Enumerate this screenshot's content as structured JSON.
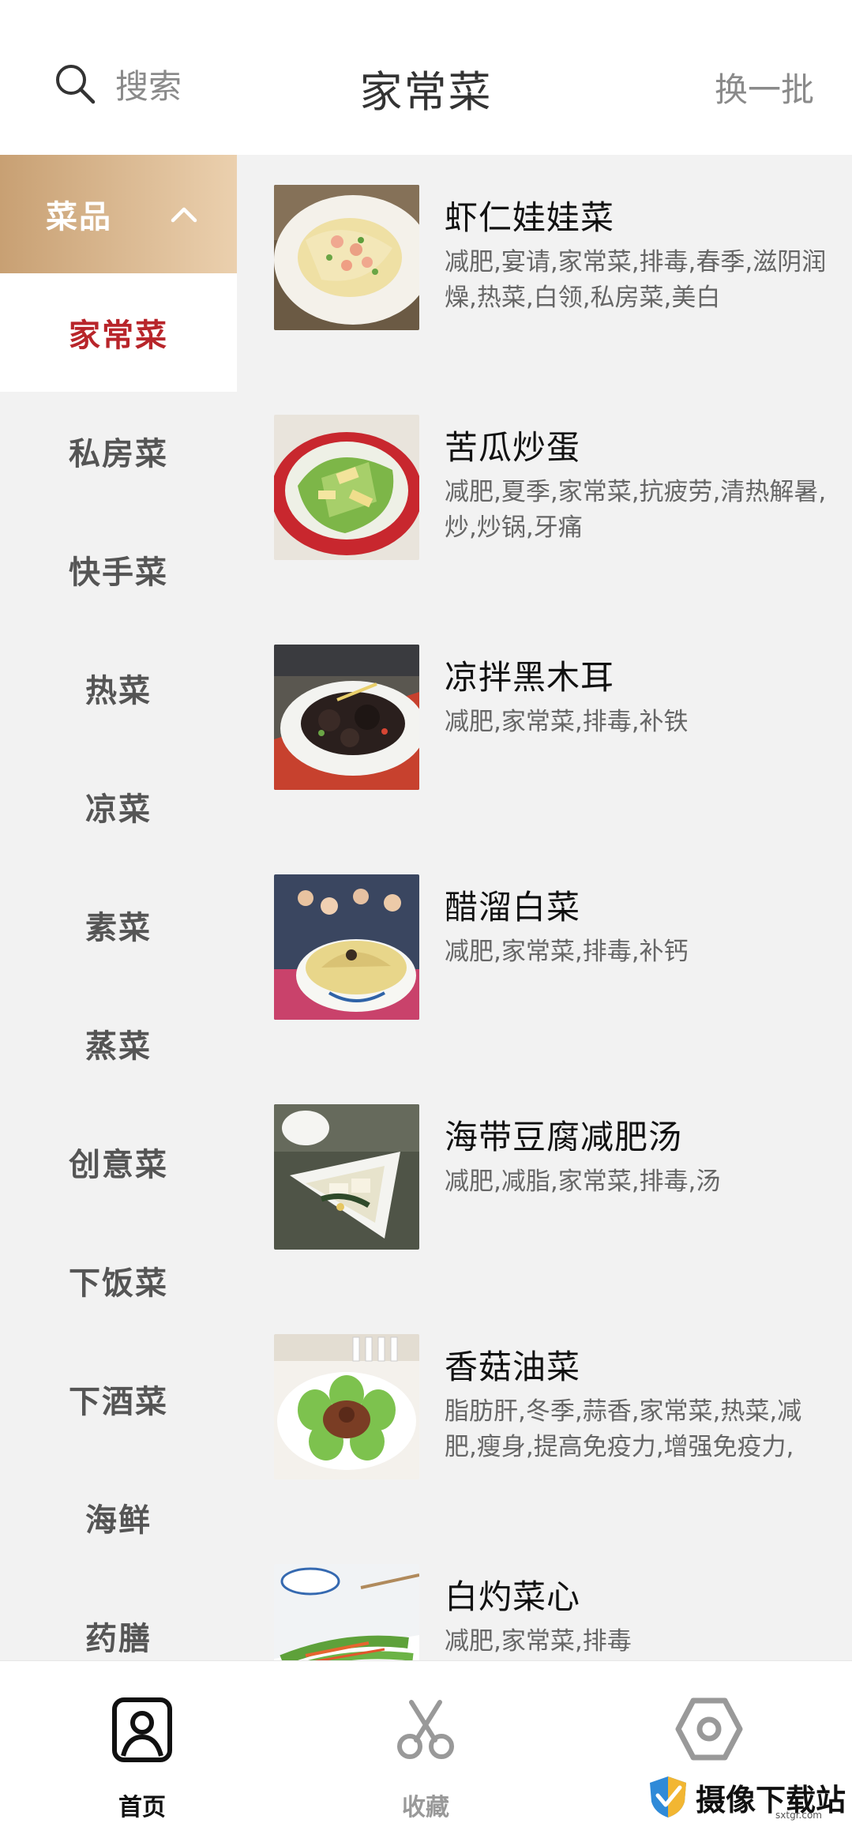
{
  "header": {
    "search_label": "搜索",
    "title": "家常菜",
    "refresh_label": "换一批"
  },
  "sidebar": {
    "header_label": "菜品",
    "items": [
      {
        "label": "家常菜",
        "active": true
      },
      {
        "label": "私房菜"
      },
      {
        "label": "快手菜"
      },
      {
        "label": "热菜"
      },
      {
        "label": "凉菜"
      },
      {
        "label": "素菜"
      },
      {
        "label": "蒸菜"
      },
      {
        "label": "创意菜"
      },
      {
        "label": "下饭菜"
      },
      {
        "label": "下酒菜"
      },
      {
        "label": "海鲜"
      },
      {
        "label": "药膳"
      }
    ]
  },
  "recipes": [
    {
      "title": "虾仁娃娃菜",
      "tags": "减肥,宴请,家常菜,排毒,春季,滋阴润燥,热菜,白领,私房菜,美白"
    },
    {
      "title": "苦瓜炒蛋",
      "tags": "减肥,夏季,家常菜,抗疲劳,清热解暑,炒,炒锅,牙痛"
    },
    {
      "title": "凉拌黑木耳",
      "tags": "减肥,家常菜,排毒,补铁"
    },
    {
      "title": "醋溜白菜",
      "tags": "减肥,家常菜,排毒,补钙"
    },
    {
      "title": "海带豆腐减肥汤",
      "tags": "减肥,减脂,家常菜,排毒,汤"
    },
    {
      "title": "香菇油菜",
      "tags": "脂肪肝,冬季,蒜香,家常菜,热菜,减肥,瘦身,提高免疫力,增强免疫力,"
    },
    {
      "title": "白灼菜心",
      "tags": "减肥,家常菜,排毒"
    }
  ],
  "tabbar": {
    "home_label": "首页",
    "favorites_label": "收藏",
    "settings_label": ""
  },
  "watermark": {
    "text": "摄像下载站",
    "sub": "sxtgr.com"
  },
  "colors": {
    "accent": "#b8252a",
    "category_header_start": "#c8a073",
    "category_header_end": "#ebd0ae"
  }
}
